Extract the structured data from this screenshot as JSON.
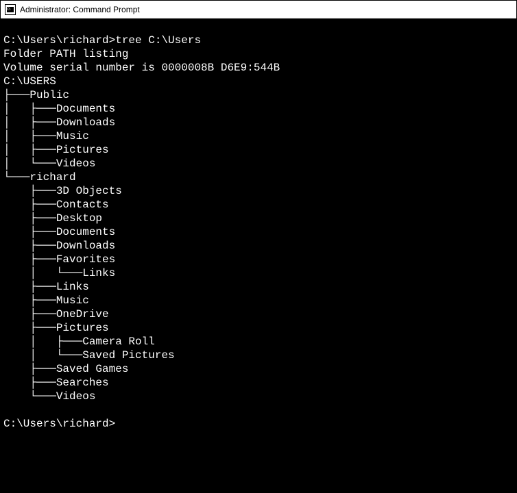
{
  "window": {
    "title": "Administrator: Command Prompt"
  },
  "terminal": {
    "blank1": "",
    "prompt1": "C:\\Users\\richard>tree C:\\Users",
    "header1": "Folder PATH listing",
    "header2": "Volume serial number is 0000008B D6E9:544B",
    "root": "C:\\USERS",
    "tree": {
      "l1": "├───Public",
      "l2": "│   ├───Documents",
      "l3": "│   ├───Downloads",
      "l4": "│   ├───Music",
      "l5": "│   ├───Pictures",
      "l6": "│   └───Videos",
      "l7": "└───richard",
      "l8": "    ├───3D Objects",
      "l9": "    ├───Contacts",
      "l10": "    ├───Desktop",
      "l11": "    ├───Documents",
      "l12": "    ├───Downloads",
      "l13": "    ├───Favorites",
      "l14": "    │   └───Links",
      "l15": "    ├───Links",
      "l16": "    ├───Music",
      "l17": "    ├───OneDrive",
      "l18": "    ├───Pictures",
      "l19": "    │   ├───Camera Roll",
      "l20": "    │   └───Saved Pictures",
      "l21": "    ├───Saved Games",
      "l22": "    ├───Searches",
      "l23": "    └───Videos"
    },
    "blank2": "",
    "prompt2": "C:\\Users\\richard>"
  }
}
